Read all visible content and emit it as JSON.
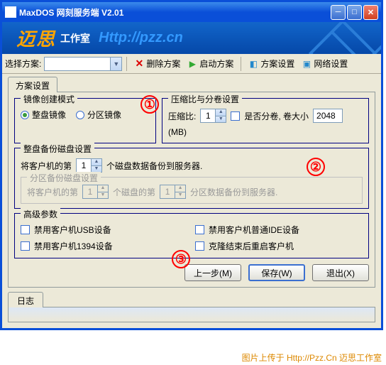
{
  "window": {
    "title": "MaxDOS 网刻服务端 V2.01"
  },
  "banner": {
    "logo": "迈思",
    "sub": "工作室",
    "url": "Http://pzz.cn"
  },
  "toolbar": {
    "scheme_label": "选择方案:",
    "delete": "删除方案",
    "start": "启动方案",
    "settings": "方案设置",
    "network": "网络设置"
  },
  "tabs": {
    "scheme_settings": "方案设置"
  },
  "mirror_mode": {
    "legend": "镜像创建模式",
    "full_disk": "整盘镜像",
    "partition": "分区镜像"
  },
  "compress": {
    "legend": "压缩比与分卷设置",
    "ratio_label": "压缩比:",
    "ratio_value": "1",
    "split_label": "是否分卷, 卷大小",
    "split_value": "2048",
    "unit": "(MB)"
  },
  "fulldisk_backup": {
    "legend": "整盘备份磁盘设置",
    "prefix": "将客户机的第",
    "disk_value": "1",
    "suffix": "个磁盘数据备份到服务器."
  },
  "partition_backup": {
    "legend": "分区备份磁盘设置",
    "prefix": "将客户机的第",
    "disk_value": "1",
    "middle": "个磁盘的第",
    "part_value": "1",
    "suffix": "分区数据备份到服务器."
  },
  "advanced": {
    "legend": "高级参数",
    "disable_usb": "禁用客户机USB设备",
    "disable_ide": "禁用客户机普通IDE设备",
    "disable_1394": "禁用客户机1394设备",
    "reboot_after": "克隆结束后重启客户机"
  },
  "buttons": {
    "prev": "上一步(M)",
    "save": "保存(W)",
    "exit": "退出(X)"
  },
  "log_tab": "日志",
  "annotations": {
    "one": "①",
    "two": "②",
    "three": "③"
  },
  "watermark": "图片上传于 Http://Pzz.Cn 迈思工作室"
}
